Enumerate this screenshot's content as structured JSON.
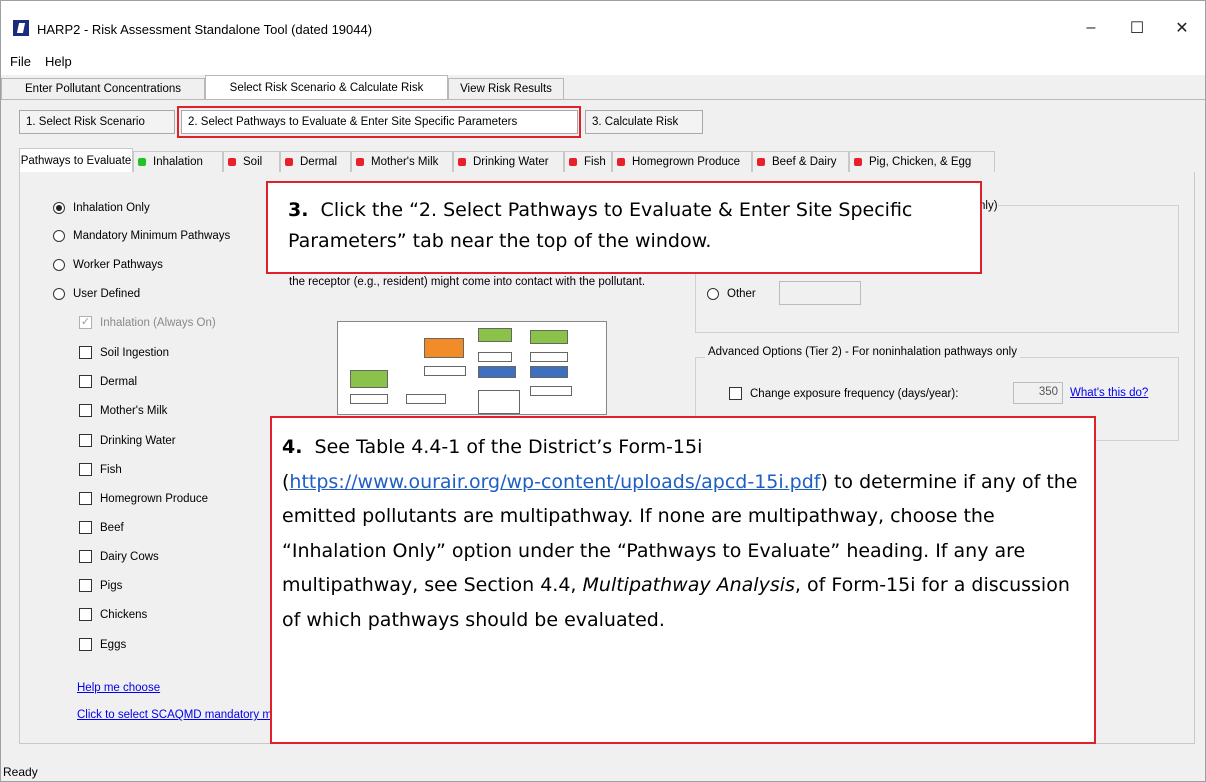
{
  "window": {
    "title": "HARP2 - Risk Assessment Standalone Tool (dated 19044)",
    "minimize": "–",
    "maximize": "☐",
    "close": "✕"
  },
  "menu": [
    "File",
    "Help"
  ],
  "main_tabs": [
    "Enter Pollutant Concentrations",
    "Select Risk Scenario & Calculate Risk",
    "View Risk Results"
  ],
  "sub_steps": [
    "1. Select Risk Scenario",
    "2. Select Pathways to Evaluate & Enter Site Specific Parameters",
    "3. Calculate Risk"
  ],
  "pathway_tabs": [
    {
      "label": "Pathways to Evaluate",
      "status": "none"
    },
    {
      "label": "Inhalation",
      "status": "green"
    },
    {
      "label": "Soil",
      "status": "red"
    },
    {
      "label": "Dermal",
      "status": "red"
    },
    {
      "label": "Mother's Milk",
      "status": "red"
    },
    {
      "label": "Drinking Water",
      "status": "red"
    },
    {
      "label": "Fish",
      "status": "red"
    },
    {
      "label": "Homegrown Produce",
      "status": "red"
    },
    {
      "label": "Beef & Dairy",
      "status": "red"
    },
    {
      "label": "Pig, Chicken, & Egg",
      "status": "red"
    }
  ],
  "colors": {
    "green": "#22c322",
    "red": "#e8202a",
    "callout_border": "#e0202a",
    "link": "#0000ee"
  },
  "radios": [
    "Inhalation Only",
    "Mandatory Minimum Pathways",
    "Worker Pathways",
    "User Defined"
  ],
  "selected_radio": "Inhalation Only",
  "always_on": "Inhalation (Always On)",
  "checkboxes": [
    "Soil Ingestion",
    "Dermal",
    "Mother's Milk",
    "Drinking Water",
    "Fish",
    "Homegrown Produce",
    "Beef",
    "Dairy Cows",
    "Pigs",
    "Chickens",
    "Eggs"
  ],
  "links": {
    "help": "Help me choose",
    "scaqmd": "Click to select SCAQMD mandatory minimum pathways",
    "whats_this": "What's this do?"
  },
  "description_partial": "the receptor (e.g., resident) might come into contact with the pollutant.",
  "hidden_group_suffix": "nly)",
  "other_label": "Other",
  "advanced": {
    "legend": "Advanced Options (Tier 2) - For noninhalation pathways only",
    "exposure_label": "Change exposure frequency (days/year):",
    "exposure_value": "350"
  },
  "callout3": {
    "number": "3.",
    "text": "Click the “2. Select Pathways to Evaluate & Enter Site Specific Parameters” tab near the top of the window."
  },
  "callout4": {
    "number": "4.",
    "line1": "See Table 4.4-1 of the District’s Form-15i",
    "url": "https://www.ourair.org/wp-content/uploads/apcd-15i.pdf",
    "text_after_url": ") to determine if any of the emitted pollutants are multipathway.  If none are multipathway, choose the “Inhalation Only” option under the “Pathways to Evaluate” heading.  If any are multipathway, see Section 4.4, ",
    "italic": "Multipathway Analysis",
    "text_end": ", of Form-15i for a discussion of which pathways should be evaluated."
  },
  "status": "Ready"
}
